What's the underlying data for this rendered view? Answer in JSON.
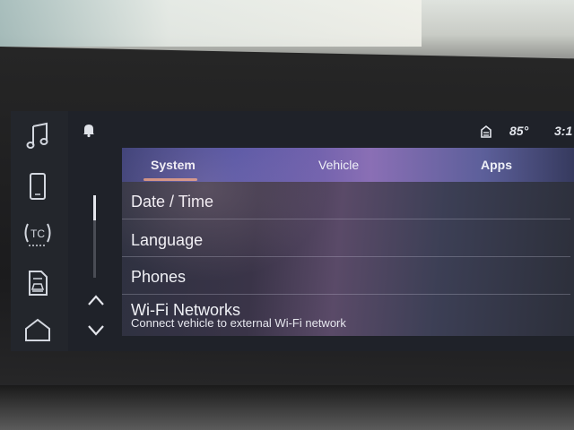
{
  "status": {
    "temperature": "85°",
    "time": "3:1"
  },
  "tabs": [
    {
      "label": "System"
    },
    {
      "label": "Vehicle"
    },
    {
      "label": "Apps"
    }
  ],
  "rail": {
    "items": [
      {
        "icon": "music-note-icon"
      },
      {
        "icon": "phone-icon"
      },
      {
        "icon": "traction-control-icon",
        "label": "TC"
      },
      {
        "icon": "vehicle-info-icon"
      },
      {
        "icon": "home-icon"
      }
    ]
  },
  "settings": {
    "items": [
      {
        "label": "Date / Time"
      },
      {
        "label": "Language"
      },
      {
        "label": "Phones"
      },
      {
        "label": "Wi-Fi Networks",
        "sublabel": "Connect vehicle to external Wi-Fi network"
      }
    ]
  },
  "colors": {
    "accent": "#f1a07a",
    "tab_bar": "#4e4fa1",
    "text": "#f0f1f6"
  }
}
